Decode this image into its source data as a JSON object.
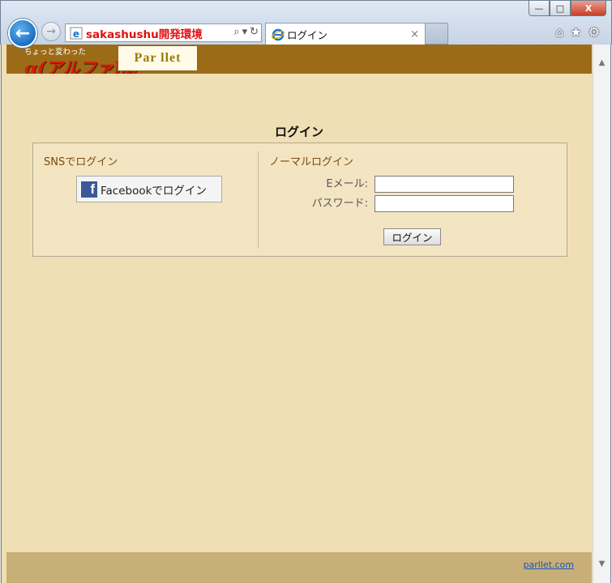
{
  "browser": {
    "address": "sakashushu開発環境",
    "tab_title": "ログイン",
    "tab_close": "×",
    "minimize": "—",
    "maximize": "□",
    "close": "X",
    "back": "←",
    "forward": "→",
    "search_glyph": "⌕",
    "dropdown_glyph": "▾",
    "refresh_glyph": "↻",
    "home_icon": "⌂",
    "star_icon": "★",
    "gear_icon": "⚙"
  },
  "site": {
    "logo_small": "ちょっと変わった",
    "logo_alpha": "α(アルファ)版",
    "logo_brand": "Par llet"
  },
  "login": {
    "title": "ログイン",
    "sns_heading": "SNSでログイン",
    "facebook_logo": "f",
    "facebook_button": "Facebookでログイン",
    "normal_heading": "ノーマルログイン",
    "email_label": "Eメール:",
    "password_label": "パスワード:",
    "submit": "ログイン"
  },
  "footer": {
    "link": "parllet.com"
  },
  "colors": {
    "header": "#9c6b18",
    "page": "#f0dfb4",
    "footer": "#c8af77",
    "address_text": "#e01010"
  }
}
